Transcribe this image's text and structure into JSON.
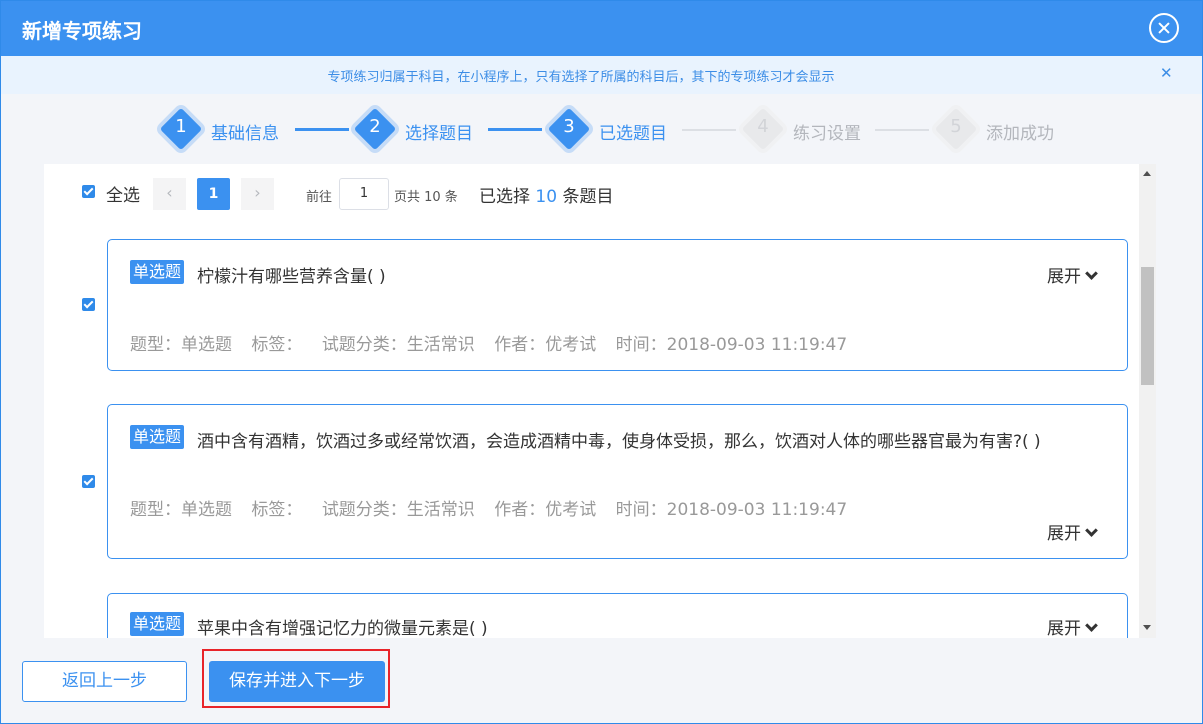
{
  "dialog": {
    "title": "新增专项练习",
    "notice": "专项练习归属于科目，在小程序上，只有选择了所属的科目后，其下的专项练习才会显示"
  },
  "steps": [
    {
      "num": "1",
      "label": "基础信息"
    },
    {
      "num": "2",
      "label": "选择题目"
    },
    {
      "num": "3",
      "label": "已选题目"
    },
    {
      "num": "4",
      "label": "练习设置"
    },
    {
      "num": "5",
      "label": "添加成功"
    }
  ],
  "toolbar": {
    "select_all": "全选",
    "prev": "‹",
    "current_page": "1",
    "next": "›",
    "goto_prefix": "前往",
    "goto_value": "1",
    "total_suffix": "页共 10 条",
    "selected_prefix": "已选择",
    "selected_count": "10",
    "selected_suffix": "条题目"
  },
  "questions": [
    {
      "tag": "单选题",
      "text": "柠檬汁有哪些营养含量( )",
      "meta_type": "题型：单选题",
      "meta_tags": "标签：",
      "meta_category": "试题分类：生活常识",
      "meta_author": "作者：优考试",
      "meta_time": "时间：2018-09-03 11:19:47",
      "expand": "展开"
    },
    {
      "tag": "单选题",
      "text": "酒中含有酒精，饮酒过多或经常饮酒，会造成酒精中毒，使身体受损，那么，饮酒对人体的哪些器官最为有害?( )",
      "meta_type": "题型：单选题",
      "meta_tags": "标签：",
      "meta_category": "试题分类：生活常识",
      "meta_author": "作者：优考试",
      "meta_time": "时间：2018-09-03 11:19:47",
      "expand": "展开"
    },
    {
      "tag": "单选题",
      "text": "苹果中含有增强记忆力的微量元素是( )",
      "expand": "展开"
    }
  ],
  "footer": {
    "back": "返回上一步",
    "next": "保存并进入下一步"
  },
  "colors": {
    "primary": "#3b91f0",
    "highlight": "#e8242a"
  }
}
